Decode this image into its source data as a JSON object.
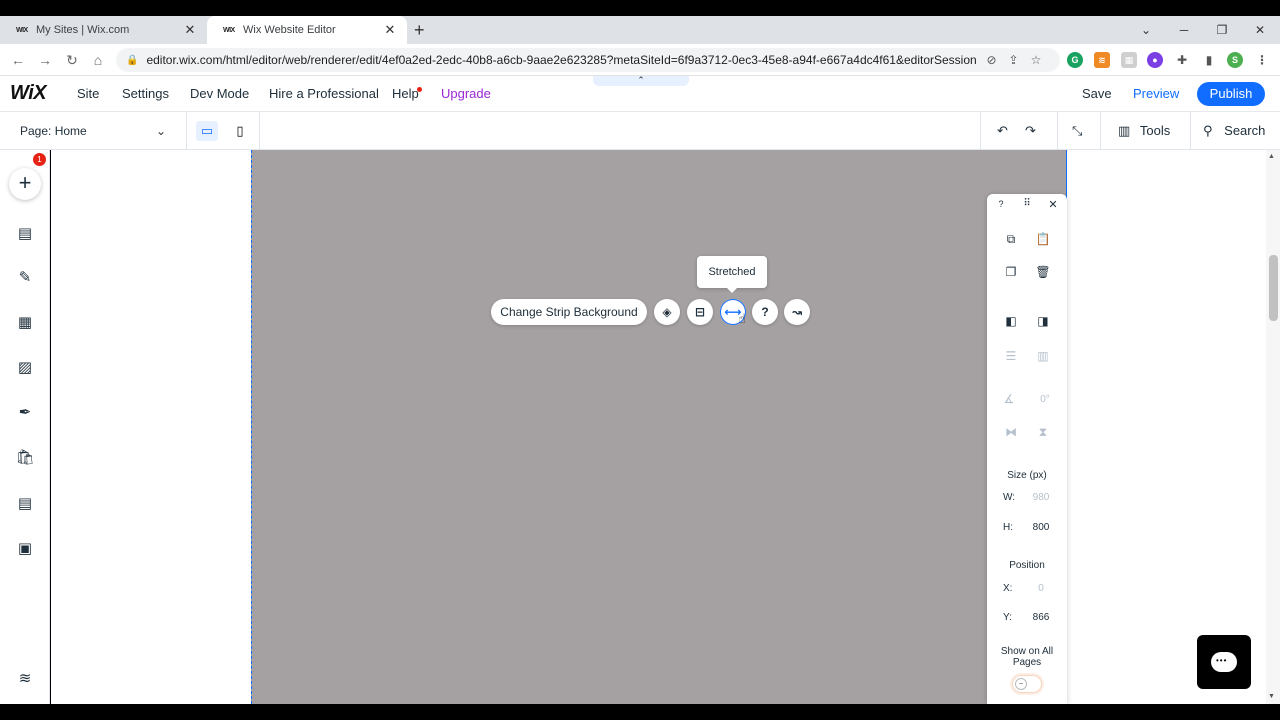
{
  "browser": {
    "tabs": [
      {
        "favicon": "WIX",
        "title": "My Sites | Wix.com"
      },
      {
        "favicon": "WIX",
        "title": "Wix Website Editor"
      }
    ],
    "url": "editor.wix.com/html/editor/web/renderer/edit/4ef0a2ed-2edc-40b8-a6cb-9aae2e623285?metaSiteId=6f9a3712-0ec3-45e8-a94f-e667a4dc4f61&editorSessionI...",
    "profile_initial": "S"
  },
  "wix": {
    "logo": "WiX",
    "menu": [
      "Site",
      "Settings",
      "Dev Mode",
      "Hire a Professional",
      "Help",
      "Upgrade"
    ],
    "save": "Save",
    "preview": "Preview",
    "publish": "Publish",
    "accent": "#116dff"
  },
  "subbar": {
    "page_selector": "Page: Home",
    "tools": "Tools",
    "search": "Search"
  },
  "left_tools": {
    "badge_count": "1"
  },
  "canvas": {
    "strip_color": "#a5a1a3",
    "change_bg_label": "Change Strip Background",
    "tooltip": "Stretched"
  },
  "panel": {
    "help": "?",
    "angle_value": "0°",
    "size_label": "Size (px)",
    "w_key": "W:",
    "w_value": "980",
    "h_key": "H:",
    "h_value": "800",
    "position_label": "Position",
    "x_key": "X:",
    "x_value": "0",
    "y_key": "Y:",
    "y_value": "866",
    "show_all_pages": "Show on All Pages"
  }
}
